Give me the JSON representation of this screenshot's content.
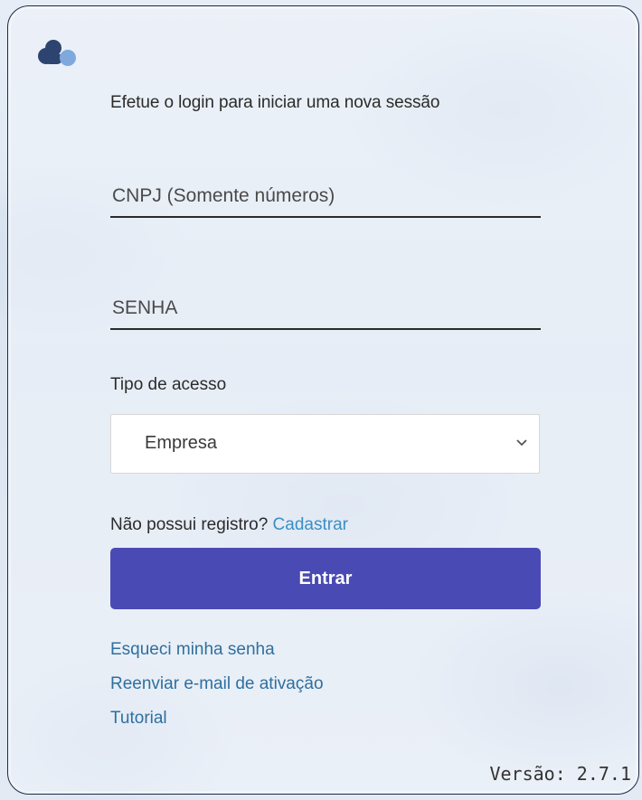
{
  "login": {
    "subtitle": "Efetue o login para iniciar uma nova sessão",
    "cnpj_placeholder": "CNPJ (Somente números)",
    "senha_placeholder": "SENHA",
    "tipo_label": "Tipo de acesso",
    "tipo_selected": "Empresa",
    "register_text": "Não possui registro?",
    "register_link": "Cadastrar",
    "submit_label": "Entrar",
    "links": [
      "Esqueci minha senha",
      "Reenviar e-mail de ativação",
      "Tutorial"
    ],
    "version": "Versão: 2.7.1"
  },
  "icons": {
    "logo": "cloud-logo-icon",
    "select_arrow": "chevron-down-icon"
  },
  "colors": {
    "primary_button": "#4a4ab5",
    "link": "#2f6f9f",
    "register_link": "#3a8fc4",
    "logo_dark": "#2d4470",
    "logo_light": "#7fa9dd"
  }
}
